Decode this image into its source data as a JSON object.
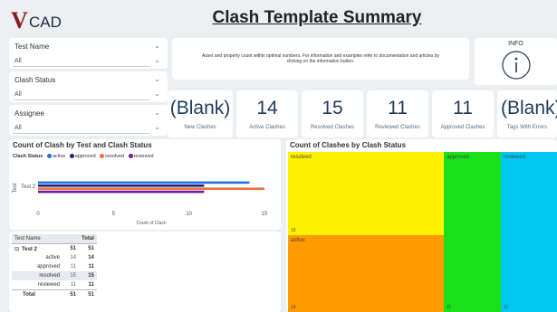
{
  "app": {
    "logo_v": "V",
    "logo_text": "CAD",
    "title": "Clash Template Summary"
  },
  "filters": [
    {
      "label": "Test Name",
      "value": "All"
    },
    {
      "label": "Clash Status",
      "value": "All"
    },
    {
      "label": "Assignee",
      "value": "All"
    }
  ],
  "info": {
    "description": "Asset and property count within optimal numbers. For information and examples refer to documentation and articles by clicking on the information button.",
    "label": "INFO"
  },
  "kpis": [
    {
      "value": "(Blank)",
      "label": "New Clashes"
    },
    {
      "value": "14",
      "label": "Active Clashes"
    },
    {
      "value": "15",
      "label": "Resolved Clashes"
    },
    {
      "value": "11",
      "label": "Reviewed Clashes"
    },
    {
      "value": "11",
      "label": "Approved Clashes"
    },
    {
      "value": "(Blank)",
      "label": "Tags With Errors"
    }
  ],
  "bar_chart_title": "Count of Clash by Test and Clash Status",
  "bar_legend_title": "Clash Status",
  "bar_legend": [
    {
      "name": "active",
      "color": "#1f6fe0"
    },
    {
      "name": "approved",
      "color": "#1a237e"
    },
    {
      "name": "resolved",
      "color": "#f26d3d"
    },
    {
      "name": "reviewed",
      "color": "#6a1b9a"
    }
  ],
  "matrix": {
    "headers": [
      "Test Name",
      "Total"
    ],
    "group": {
      "name": "Test 2",
      "v1": "51",
      "total": "51"
    },
    "rows": [
      {
        "name": "active",
        "v1": "14",
        "total": "14"
      },
      {
        "name": "approved",
        "v1": "11",
        "total": "11"
      },
      {
        "name": "resolved",
        "v1": "15",
        "total": "15"
      },
      {
        "name": "reviewed",
        "v1": "11",
        "total": "11"
      }
    ],
    "total": {
      "name": "Total",
      "v1": "51",
      "total": "51"
    }
  },
  "treemap_title": "Count of Clashes by Clash Status",
  "chart_data": [
    {
      "type": "bar",
      "title": "Count of Clash by Test and Clash Status",
      "xlabel": "Count of Clash",
      "ylabel": "Test",
      "categories": [
        "Test 2"
      ],
      "xlim": [
        0,
        15
      ],
      "x_ticks": [
        "0",
        "5",
        "10",
        "15"
      ],
      "series": [
        {
          "name": "active",
          "values": [
            14
          ],
          "color": "#1f6fe0"
        },
        {
          "name": "approved",
          "values": [
            11
          ],
          "color": "#1a237e"
        },
        {
          "name": "resolved",
          "values": [
            15
          ],
          "color": "#f26d3d"
        },
        {
          "name": "reviewed",
          "values": [
            11
          ],
          "color": "#6a1b9a"
        }
      ],
      "legend_position": "top-left",
      "orientation": "horizontal"
    },
    {
      "type": "treemap",
      "title": "Count of Clashes by Clash Status",
      "items": [
        {
          "name": "resolved",
          "value": 15,
          "color": "#fff200"
        },
        {
          "name": "active",
          "value": 14,
          "color": "#ff9a00"
        },
        {
          "name": "approved",
          "value": 11,
          "color": "#19e119"
        },
        {
          "name": "reviewed",
          "value": 11,
          "color": "#00c8f5"
        }
      ]
    }
  ]
}
